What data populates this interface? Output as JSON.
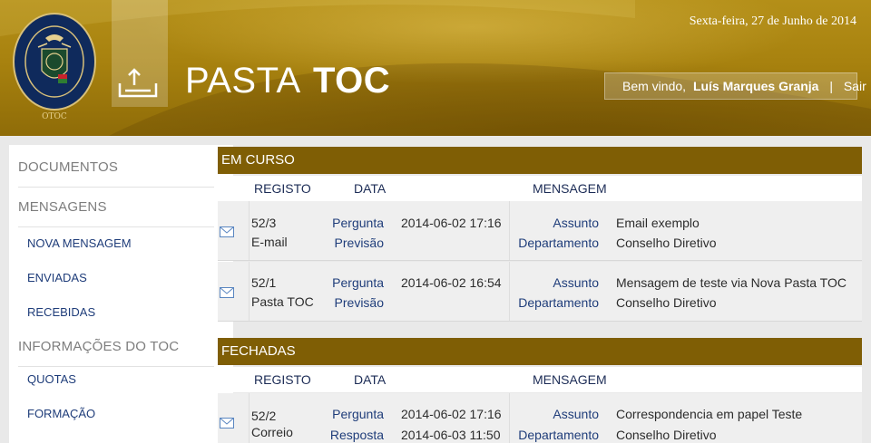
{
  "header": {
    "logo_text_top": "ORDEM DOS TÉCNICOS OFICIAIS DE CONTAS",
    "logo_text_bottom": "OTOC",
    "brand_light": "PASTA",
    "brand_bold": "TOC",
    "date": "Sexta-feira, 27 de Junho de 2014",
    "welcome_label": "Bem vindo,",
    "user_name": "Luís Marques Granja",
    "separator": "|",
    "logout_label": "Sair",
    "icons": {
      "upload": "upload-icon",
      "logo": "otoc-seal-logo"
    }
  },
  "sidebar": {
    "sections": [
      {
        "label": "DOCUMENTOS"
      },
      {
        "label": "MENSAGENS"
      },
      {
        "label": "INFORMAÇÕES DO TOC"
      }
    ],
    "items": [
      {
        "label": "NOVA MENSAGEM"
      },
      {
        "label": "ENVIADAS"
      },
      {
        "label": "RECEBIDAS"
      },
      {
        "label": "QUOTAS"
      },
      {
        "label": "FORMAÇÃO"
      }
    ]
  },
  "columns": {
    "registo": "REGISTO",
    "data": "DATA",
    "mensagem": "MENSAGEM"
  },
  "em_curso": {
    "title": "EM CURSO",
    "rows": [
      {
        "icon": "envelope-icon",
        "registo": "52/3",
        "tipo": "E-mail",
        "label1": "Pergunta",
        "date1": "2014-06-02 17:16",
        "label2": "Previsão",
        "date2": "",
        "assunto_label": "Assunto",
        "assunto": "Email exemplo",
        "departamento_label": "Departamento",
        "departamento": "Conselho Diretivo"
      },
      {
        "icon": "envelope-icon",
        "registo": "52/1",
        "tipo": "Pasta TOC",
        "label1": "Pergunta",
        "date1": "2014-06-02 16:54",
        "label2": "Previsão",
        "date2": "",
        "assunto_label": "Assunto",
        "assunto": "Mensagem de teste via Nova Pasta TOC",
        "departamento_label": "Departamento",
        "departamento": "Conselho Diretivo"
      }
    ]
  },
  "fechadas": {
    "title": "FECHADAS",
    "rows": [
      {
        "icon": "envelope-icon",
        "registo": "52/2",
        "tipo": "Correio",
        "label1": "Pergunta",
        "date1": "2014-06-02 17:16",
        "label2": "Resposta",
        "date2": "2014-06-03 11:50",
        "assunto_label": "Assunto",
        "assunto": "Correspondencia em papel Teste",
        "departamento_label": "Departamento",
        "departamento": "Conselho Diretivo"
      }
    ]
  },
  "colors": {
    "header_gold": "#a8820f",
    "section_bar": "#7f5e05",
    "link_blue": "#1f3d7a"
  }
}
